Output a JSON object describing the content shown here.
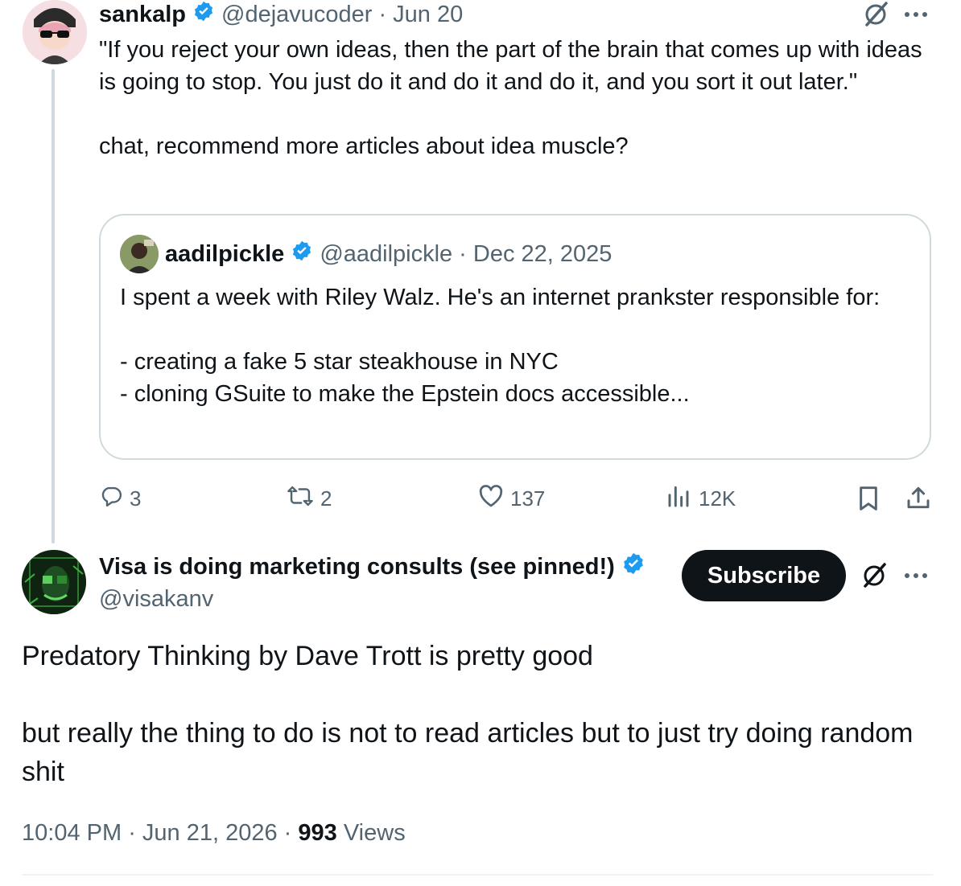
{
  "parent_tweet": {
    "author_name": "sankalp",
    "author_handle": "@dejavucoder",
    "date": "· Jun 20",
    "text": "\"If you reject your own ideas, then the part of the brain that comes up with ideas is going to stop. You just do it and do it and do it, and you sort it out later.\"\n\nchat, recommend more articles about idea muscle?",
    "quote": {
      "author_name": "aadilpickle",
      "author_handle": "@aadilpickle",
      "date": "· Dec 22, 2025",
      "text": "I spent a week with Riley Walz. He's an internet prankster responsible for:\n\n- creating a fake 5 star steakhouse in NYC\n- cloning GSuite to make the Epstein docs accessible..."
    },
    "actions": {
      "replies": "3",
      "reposts": "2",
      "likes": "137",
      "views": "12K"
    }
  },
  "main_tweet": {
    "author_name": "Visa is doing marketing consults (see pinned!)",
    "author_handle": "@visakanv",
    "subscribe_label": "Subscribe",
    "text": "Predatory Thinking by Dave Trott is pretty good\n\nbut really the thing to do is not to read articles but to just try doing random shit",
    "time": "10:04 PM",
    "date": "· Jun 21, 2026 ·",
    "views_count": "993",
    "views_label": "Views"
  },
  "colors": {
    "verified_blue": "#1d9bf0",
    "text_primary": "#0f1419",
    "text_secondary": "#536471",
    "border": "#cfd9de"
  },
  "icons": [
    "verified-icon",
    "grok-icon",
    "more-icon",
    "reply-icon",
    "repost-icon",
    "like-icon",
    "views-icon",
    "bookmark-icon",
    "share-icon"
  ]
}
